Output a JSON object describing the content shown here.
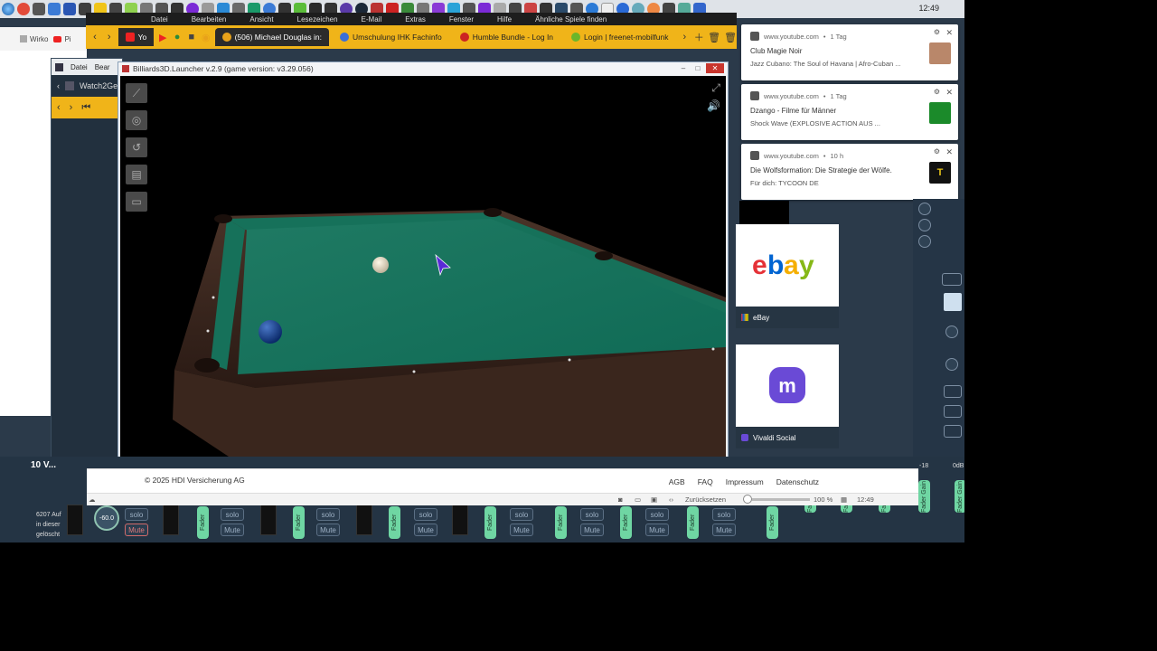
{
  "taskbar": {
    "clock": "12:49"
  },
  "bg_menu": [
    "Datei",
    "Bearbeiten",
    "Ansicht",
    "Lesezeichen",
    "E-Mail",
    "Extras",
    "Fenster",
    "Hilfe",
    "Ähnliche Spiele finden"
  ],
  "tabs": [
    {
      "label": "(506) Michael Douglas in:",
      "color": "#e8a21a"
    },
    {
      "label": "Umschulung IHK Fachinfo",
      "color": "#3b6fd6"
    },
    {
      "label": "Humble Bundle - Log In",
      "color": "#c22"
    },
    {
      "label": "Login | freenet-mobilfunk",
      "color": "#6bb62a"
    }
  ],
  "left_browser": {
    "tabs": [
      "Wirko",
      "Pi"
    ],
    "yt_tab": "Yo"
  },
  "dark_app": {
    "menu": [
      "Datei",
      "Bear"
    ],
    "item": "Watch2Ge"
  },
  "game": {
    "title": "Billiards3D.Launcher v.2.9 (game version: v3.29.056)"
  },
  "notifications": [
    {
      "source": "www.youtube.com",
      "age": "1 Tag",
      "title": "Club Magie Noir",
      "body": "Jazz Cubano: The Soul of Havana | Afro-Cuban ...",
      "thumb": "#b9876a"
    },
    {
      "source": "www.youtube.com",
      "age": "1 Tag",
      "title": "Dzango - Filme für Männer",
      "body": "Shock Wave (EXPLOSIVE ACTION AUS ...",
      "thumb": "#1b8a2a"
    },
    {
      "source": "www.youtube.com",
      "age": "10 h",
      "title": "Die Wolfsformation: Die Strategie der Wölfe.",
      "body": "Für dich: TYCOON DE",
      "thumb": "#111"
    }
  ],
  "tiles": [
    {
      "label": "eBay"
    },
    {
      "label": "Vivaldi Social"
    }
  ],
  "footer": {
    "copyright": "© 2025 HDI Versicherung AG",
    "links": [
      "AGB",
      "FAQ",
      "Impressum",
      "Datenschutz"
    ],
    "reset": "Zurücksetzen",
    "zoom": "100 %",
    "time": "12:49"
  },
  "mixer": {
    "knob_value": "-60.0",
    "solo": "solo",
    "mute": "Mute",
    "fader": "Fader",
    "fader_gain": "Fader Gain",
    "db_labels": [
      "-18",
      "0dB"
    ]
  },
  "side": {
    "left_title": "10 V...",
    "left_lines": [
      "6207 Auf",
      "in dieser",
      "gelöscht"
    ]
  }
}
